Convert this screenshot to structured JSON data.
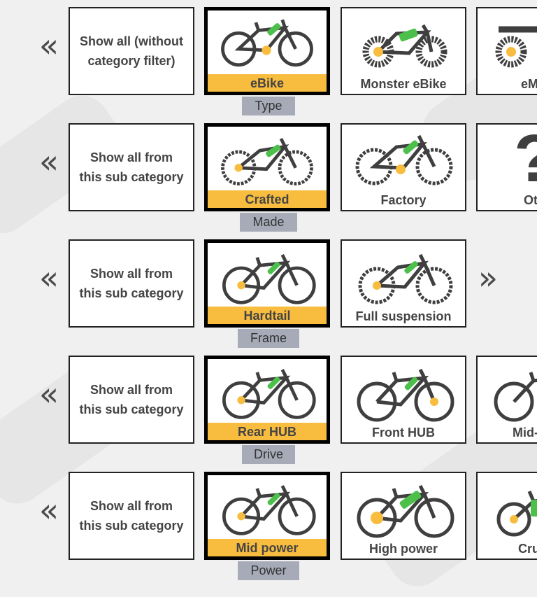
{
  "rows": [
    {
      "category": "Type",
      "show_all": "Show all (without category filter)",
      "tiles": [
        "eBike",
        "Monster eBike",
        "eM"
      ],
      "icons": [
        "ebike-icon",
        "monster-ebike-icon",
        "emoto-icon"
      ]
    },
    {
      "category": "Made",
      "show_all": "Show all from this sub category",
      "tiles": [
        "Crafted",
        "Factory",
        "Ot"
      ],
      "icons": [
        "crafted-bike-icon",
        "factory-bike-icon",
        "question-mark-icon"
      ]
    },
    {
      "category": "Frame",
      "show_all": "Show all from this sub category",
      "tiles": [
        "Hardtail",
        "Full suspension"
      ],
      "icons": [
        "hardtail-bike-icon",
        "full-suspension-bike-icon"
      ]
    },
    {
      "category": "Drive",
      "show_all": "Show all from this sub category",
      "tiles": [
        "Rear HUB",
        "Front HUB",
        "Mid-"
      ],
      "icons": [
        "rear-hub-bike-icon",
        "front-hub-bike-icon",
        "mid-drive-bike-icon"
      ]
    },
    {
      "category": "Power",
      "show_all": "Show all from this sub category",
      "tiles": [
        "Mid power",
        "High power",
        "Cru"
      ],
      "icons": [
        "mid-power-bike-icon",
        "high-power-bike-icon",
        "cruiser-bike-icon"
      ]
    }
  ],
  "nav": {
    "back": "«",
    "forward": "»"
  },
  "colors": {
    "selected": "#f8bd3f",
    "category_tag": "#a7abb8",
    "frame": "#3f3f3f",
    "battery": "#4cc04a",
    "motor": "#f8bd3f"
  }
}
